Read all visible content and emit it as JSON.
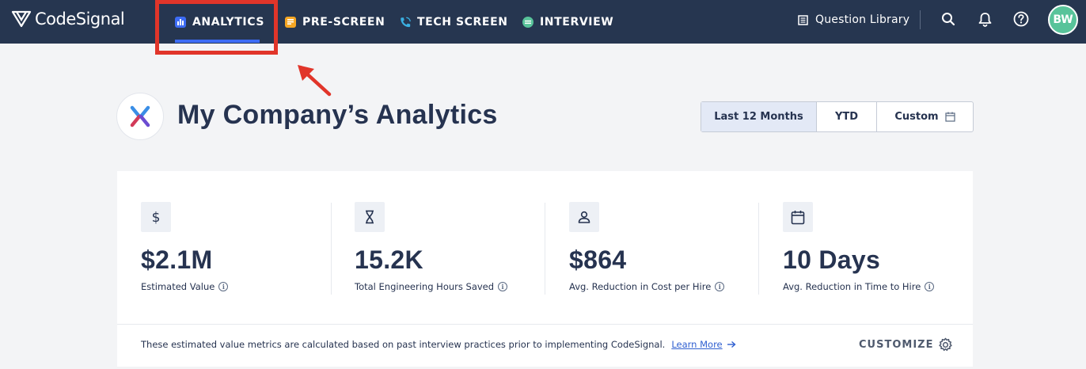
{
  "brand": {
    "name": "CodeSignal"
  },
  "nav": {
    "items": [
      {
        "label": "ANALYTICS",
        "icon": "bar-chart-icon",
        "color": "#3d6cf5"
      },
      {
        "label": "PRE-SCREEN",
        "icon": "note-icon",
        "color": "#f5a623"
      },
      {
        "label": "TECH SCREEN",
        "icon": "phone-icon",
        "color": "#3ab0e2"
      },
      {
        "label": "INTERVIEW",
        "icon": "chat-icon",
        "color": "#58c39a"
      }
    ],
    "active": "ANALYTICS"
  },
  "topbar": {
    "question_library": "Question Library",
    "avatar_initials": "BW"
  },
  "page": {
    "title": "My Company’s Analytics"
  },
  "range": {
    "options": [
      "Last 12 Months",
      "YTD",
      "Custom"
    ],
    "selected": "Last 12 Months"
  },
  "metrics": [
    {
      "icon": "dollar-icon",
      "value": "$2.1M",
      "label": "Estimated Value"
    },
    {
      "icon": "hourglass-icon",
      "value": "15.2K",
      "label": "Total Engineering Hours Saved"
    },
    {
      "icon": "person-icon",
      "value": "$864",
      "label": "Avg. Reduction in Cost per Hire"
    },
    {
      "icon": "calendar-icon",
      "value": "10 Days",
      "label": "Avg. Reduction in Time to Hire"
    }
  ],
  "footer": {
    "note": "These estimated value metrics are calculated based on past interview practices prior to implementing CodeSignal.",
    "learn_more": "Learn More",
    "customize": "CUSTOMIZE"
  },
  "annotation": {
    "highlight_color": "#e1352a"
  },
  "colors": {
    "topbar": "#263650",
    "accent": "#3d6cf5",
    "background": "#f3f4f6"
  }
}
